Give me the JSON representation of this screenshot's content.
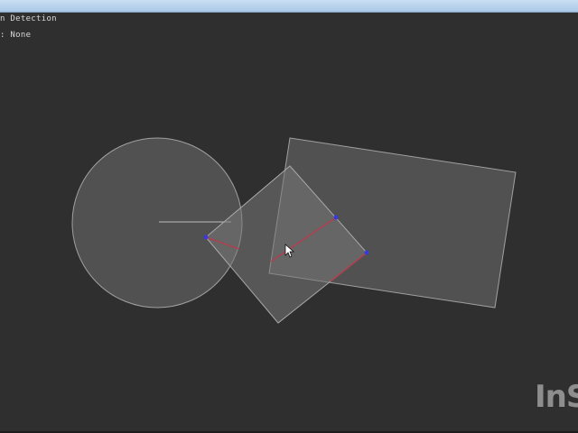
{
  "app": {
    "title_fragment": "n Detection",
    "status_fragment": ": None"
  },
  "watermark": {
    "text": "InS"
  },
  "colors": {
    "background": "#2f2f2f",
    "shape_fill": "#5a5a5a",
    "shape_stroke": "#9a9a9a",
    "contact_point": "#3a3ad8",
    "normal_line": "#b04050"
  },
  "cursor": {
    "icon": "arrow-cursor-icon"
  }
}
